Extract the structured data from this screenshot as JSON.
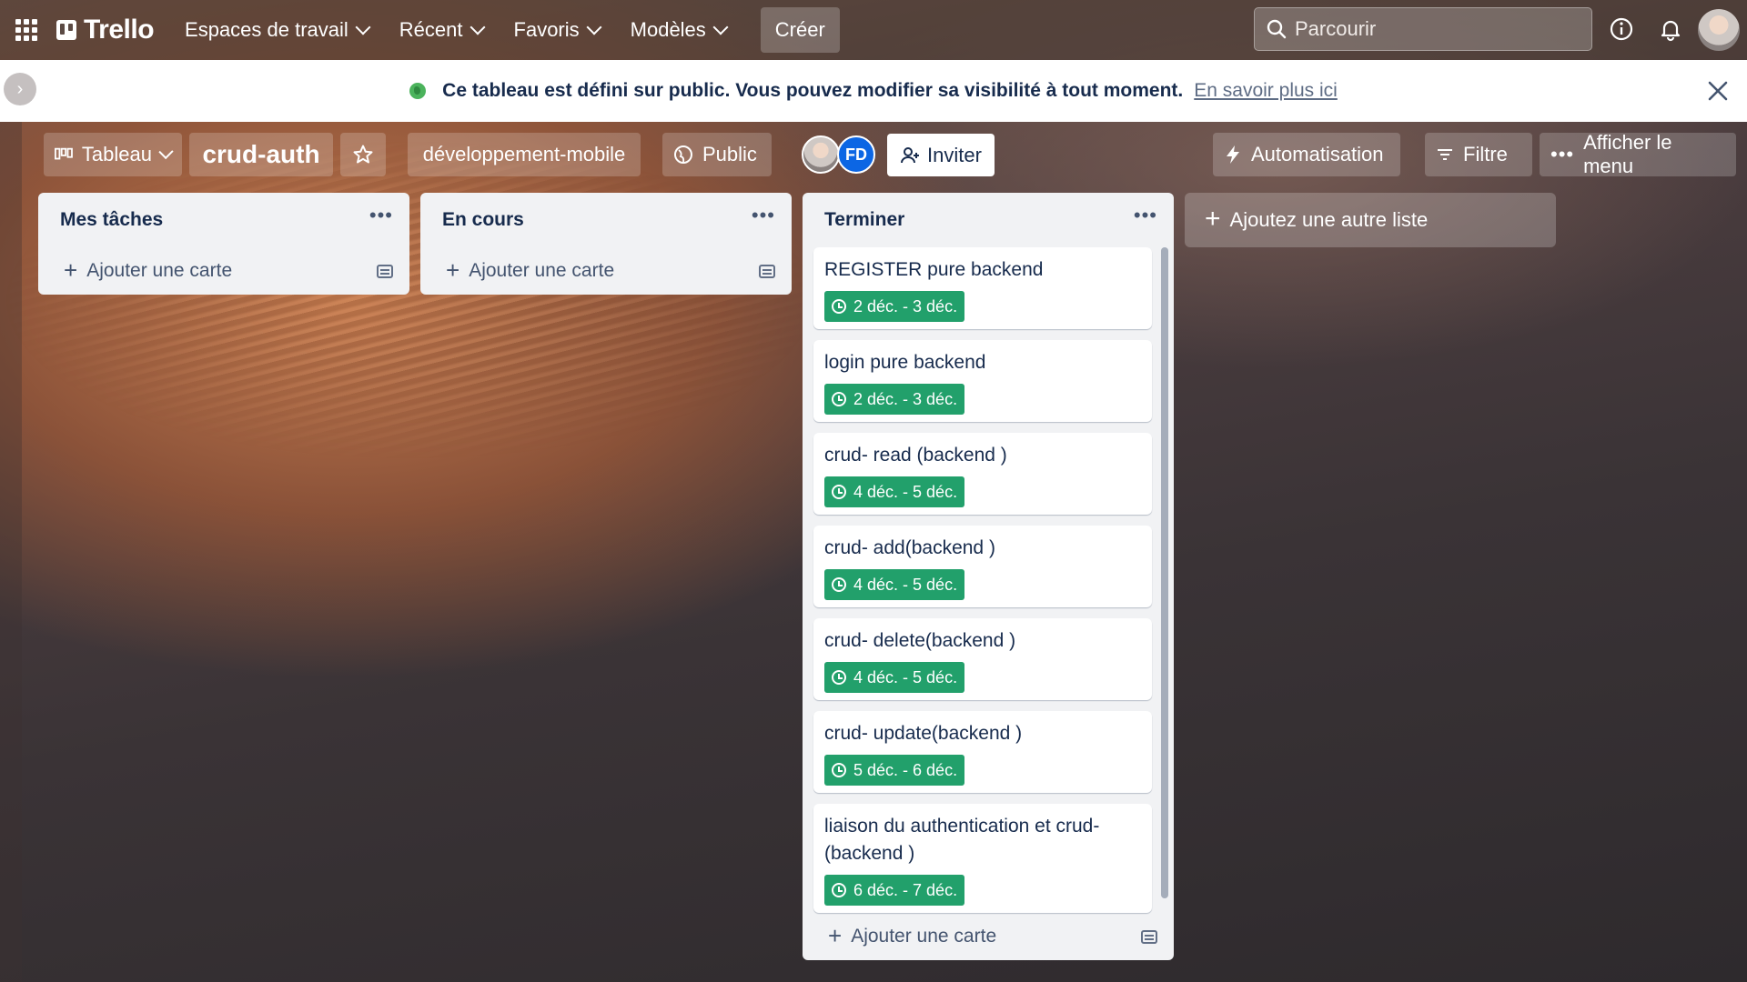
{
  "app": {
    "name": "Trello"
  },
  "topnav": {
    "items": [
      "Espaces de travail",
      "Récent",
      "Favoris",
      "Modèles"
    ],
    "create": "Créer",
    "search_placeholder": "Parcourir"
  },
  "banner": {
    "message": "Ce tableau est défini sur public. Vous pouvez modifier sa visibilité à tout moment.",
    "link": "En savoir plus ici"
  },
  "board": {
    "view": "Tableau",
    "title": "crud-auth",
    "workspace": "développement-mobile",
    "visibility": "Public",
    "member_initials": "FD",
    "invite": "Inviter",
    "automation": "Automatisation",
    "filter": "Filtre",
    "menu": "Afficher le menu"
  },
  "lists": [
    {
      "title": "Mes tâches",
      "add_card": "Ajouter une carte",
      "cards": []
    },
    {
      "title": "En cours",
      "add_card": "Ajouter une carte",
      "cards": []
    },
    {
      "title": "Terminer",
      "add_card": "Ajouter une carte",
      "cards": [
        {
          "title": "REGISTER pure backend",
          "dates": "2 déc. - 3 déc."
        },
        {
          "title": "login pure backend",
          "dates": "2 déc. - 3 déc."
        },
        {
          "title": "crud- read (backend )",
          "dates": "4 déc. - 5 déc."
        },
        {
          "title": "crud- add(backend )",
          "dates": "4 déc. - 5 déc."
        },
        {
          "title": "crud- delete(backend )",
          "dates": "4 déc. - 5 déc."
        },
        {
          "title": "crud- update(backend )",
          "dates": "5 déc. - 6 déc."
        },
        {
          "title": "liaison du authentication et crud-(backend )",
          "dates": "6 déc. - 7 déc."
        }
      ]
    }
  ],
  "add_list": "Ajoutez une autre liste",
  "colors": {
    "badge_green": "#22a06b",
    "list_bg": "#f1f2f4",
    "member_blue": "#0c66e4"
  }
}
